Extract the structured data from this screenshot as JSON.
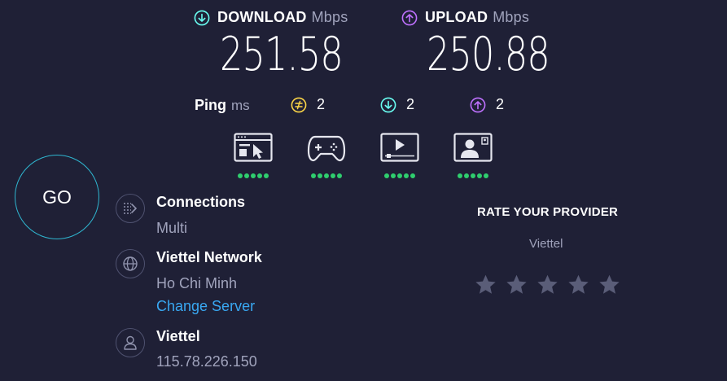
{
  "download": {
    "label": "DOWNLOAD",
    "unit": "Mbps",
    "value": "251.58"
  },
  "upload": {
    "label": "UPLOAD",
    "unit": "Mbps",
    "value": "250.88"
  },
  "ping": {
    "label": "Ping",
    "unit": "ms",
    "idle": "2",
    "download": "2",
    "upload": "2"
  },
  "quality_icons": [
    {
      "icon": "web-browsing-icon",
      "dots": 5
    },
    {
      "icon": "gaming-icon",
      "dots": 5
    },
    {
      "icon": "video-streaming-icon",
      "dots": 5
    },
    {
      "icon": "video-chat-icon",
      "dots": 5
    }
  ],
  "go_label": "GO",
  "connections": {
    "title": "Connections",
    "value": "Multi"
  },
  "server": {
    "title": "Viettel Network",
    "location": "Ho Chi Minh",
    "change_label": "Change Server"
  },
  "provider": {
    "title": "Viettel",
    "ip": "115.78.226.150"
  },
  "rate": {
    "title": "RATE YOUR PROVIDER",
    "provider": "Viettel",
    "stars_filled": 0,
    "stars_total": 5
  },
  "colors": {
    "background": "#1f2036",
    "download_accent": "#6afff3",
    "upload_accent": "#bf71ff",
    "ping_accent": "#fbd547",
    "quality_good": "#2fce6e",
    "link": "#39a8f2",
    "star_empty": "#5a5d78"
  }
}
